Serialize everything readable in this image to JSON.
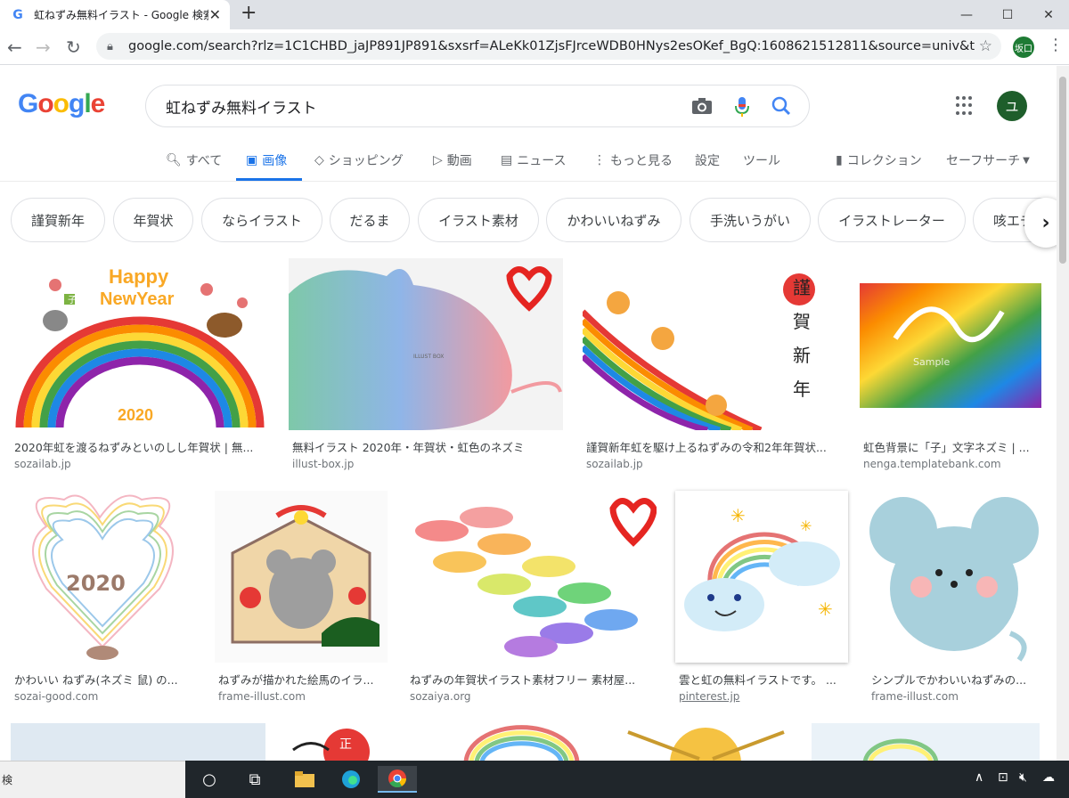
{
  "browser": {
    "tab_title": "虹ねずみ無料イラスト - Google 検索",
    "tab_close": "✕",
    "new_tab": "+",
    "url": "google.com/search?rlz=1C1CHBD_jaJP891JP891&sxsrf=ALeKk01ZjsFJrceWDB0HNys2esOKef_BgQ:1608621512811&source=univ&tbm=isch",
    "profile_label": "坂口",
    "minimize": "—",
    "maximize": "☐",
    "close": "✕"
  },
  "google": {
    "logo_letters": [
      "G",
      "o",
      "o",
      "g",
      "l",
      "e"
    ],
    "logo_colors": [
      "#4285f4",
      "#ea4335",
      "#fbbc05",
      "#4285f4",
      "#34a853",
      "#ea4335"
    ],
    "query": "虹ねずみ無料イラスト",
    "avatar_letter": "ユ"
  },
  "search_tabs": {
    "all": "すべて",
    "images": "画像",
    "shopping": "ショッピング",
    "videos": "動画",
    "news": "ニュース",
    "more": "もっと見る",
    "settings": "設定",
    "tools": "ツール",
    "collection": "コレクション",
    "safesearch": "セーフサーチ"
  },
  "chips": [
    "謹賀新年",
    "年賀状",
    "ならイラスト",
    "だるま",
    "イラスト素材",
    "かわいいねずみ",
    "手洗いうがい",
    "イラストレーター",
    "咳エチ"
  ],
  "results": [
    {
      "caption": "2020年虹を渡るねずみといのしし年賀状 | 無...",
      "source": "sozailab.jp",
      "texts": [
        "Happy",
        "NewYear",
        "2020",
        "子"
      ]
    },
    {
      "caption": "無料イラスト 2020年・年賀状・虹色のネズミ",
      "source": "illust-box.jp",
      "texts": [
        "ILLUST BOX"
      ]
    },
    {
      "caption": "謹賀新年虹を駆け上るねずみの令和2年年賀状...",
      "source": "sozailab.jp",
      "texts": [
        "謹",
        "賀",
        "新",
        "年"
      ]
    },
    {
      "caption": "虹色背景に「子」文字ネズミ | ...",
      "source": "nenga.templatebank.com",
      "texts": [
        "Sample"
      ]
    },
    {
      "caption": "かわいい ねずみ(ネズミ 鼠) の...",
      "source": "sozai-good.com",
      "texts": [
        "2020"
      ]
    },
    {
      "caption": "ねずみが描かれた絵馬のイラ...",
      "source": "frame-illust.com",
      "texts": []
    },
    {
      "caption": "ねずみの年賀状イラスト素材フリー 素材屋...",
      "source": "sozaiya.org",
      "texts": []
    },
    {
      "caption": "雲と虹の無料イラストです。 ...",
      "source": "pinterest.jp",
      "texts": []
    },
    {
      "caption": "シンプルでかわいいねずみの...",
      "source": "frame-illust.com",
      "texts": []
    }
  ],
  "bottom_row_texts": [
    "正"
  ],
  "taskbar": {
    "search_label": "検"
  }
}
